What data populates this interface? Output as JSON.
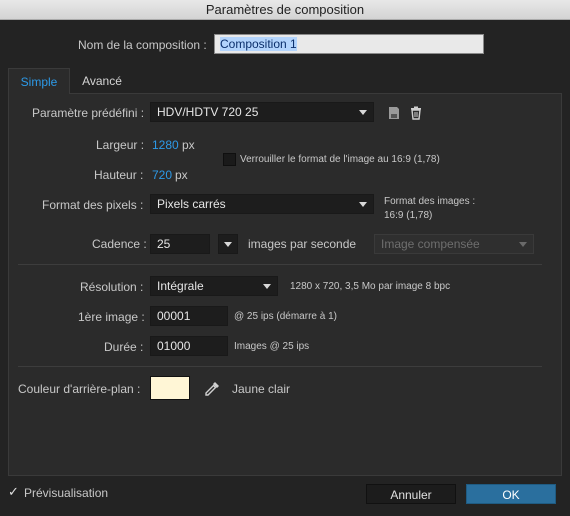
{
  "window": {
    "title": "Paramètres de composition"
  },
  "composition": {
    "name_label": "Nom de la composition :",
    "name_value": "Composition 1"
  },
  "tabs": [
    {
      "label": "Simple"
    },
    {
      "label": "Avancé"
    }
  ],
  "preset": {
    "label": "Paramètre prédéfini :",
    "value": "HDV/HDTV 720 25"
  },
  "size": {
    "width_label": "Largeur :",
    "width_value": "1280",
    "width_unit": "px",
    "height_label": "Hauteur :",
    "height_value": "720",
    "height_unit": "px",
    "lock_label": "Verrouiller le format de l'image au 16:9 (1,78)"
  },
  "pixel_format": {
    "label": "Format des pixels :",
    "value": "Pixels carrés",
    "image_format_label": "Format des images :",
    "image_format_value": "16:9 (1,78)"
  },
  "framerate": {
    "label": "Cadence :",
    "value": "25",
    "unit_label": "images par seconde",
    "mode": "Image compensée"
  },
  "resolution": {
    "label": "Résolution :",
    "value": "Intégrale",
    "info": "1280 x 720, 3,5 Mo par image 8 bpc"
  },
  "start_frame": {
    "label": "1ère image :",
    "value": "00001",
    "info": "@ 25 ips (démarre à 1)"
  },
  "duration": {
    "label": "Durée :",
    "value": "01000",
    "info": "Images @ 25 ips"
  },
  "background": {
    "label": "Couleur d'arrière-plan :",
    "color": "#FFF6D6",
    "color_name": "Jaune clair"
  },
  "footer": {
    "preview_label": "Prévisualisation",
    "preview_checked": true,
    "cancel_label": "Annuler",
    "ok_label": "OK"
  }
}
